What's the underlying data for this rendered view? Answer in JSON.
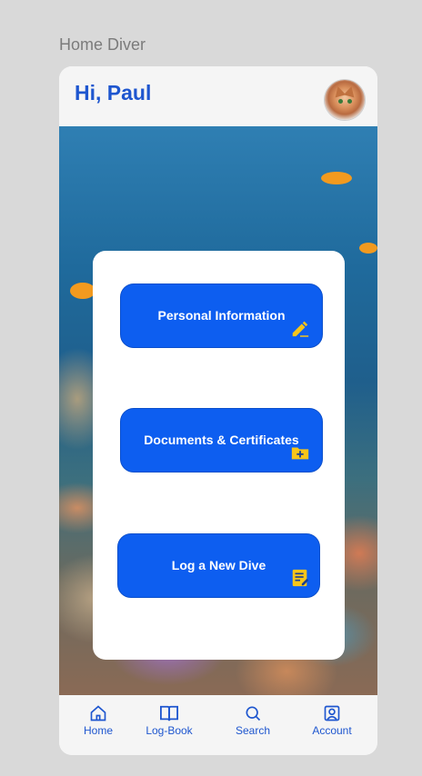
{
  "frame_label": "Home Diver",
  "header": {
    "greeting": "Hi, Paul"
  },
  "actions": [
    {
      "label": "Personal Information",
      "icon": "pencil-icon"
    },
    {
      "label": "Documents & Certificates",
      "icon": "folder-add-icon"
    },
    {
      "label": "Log a New Dive",
      "icon": "log-note-icon"
    }
  ],
  "nav": [
    {
      "label": "Home",
      "icon": "home-icon"
    },
    {
      "label": "Log-Book",
      "icon": "book-icon"
    },
    {
      "label": "Search",
      "icon": "search-icon"
    },
    {
      "label": "Account",
      "icon": "account-icon"
    }
  ],
  "colors": {
    "accent": "#0d5ef0",
    "title": "#1e56cf",
    "icon_yellow": "#f7c51a"
  }
}
